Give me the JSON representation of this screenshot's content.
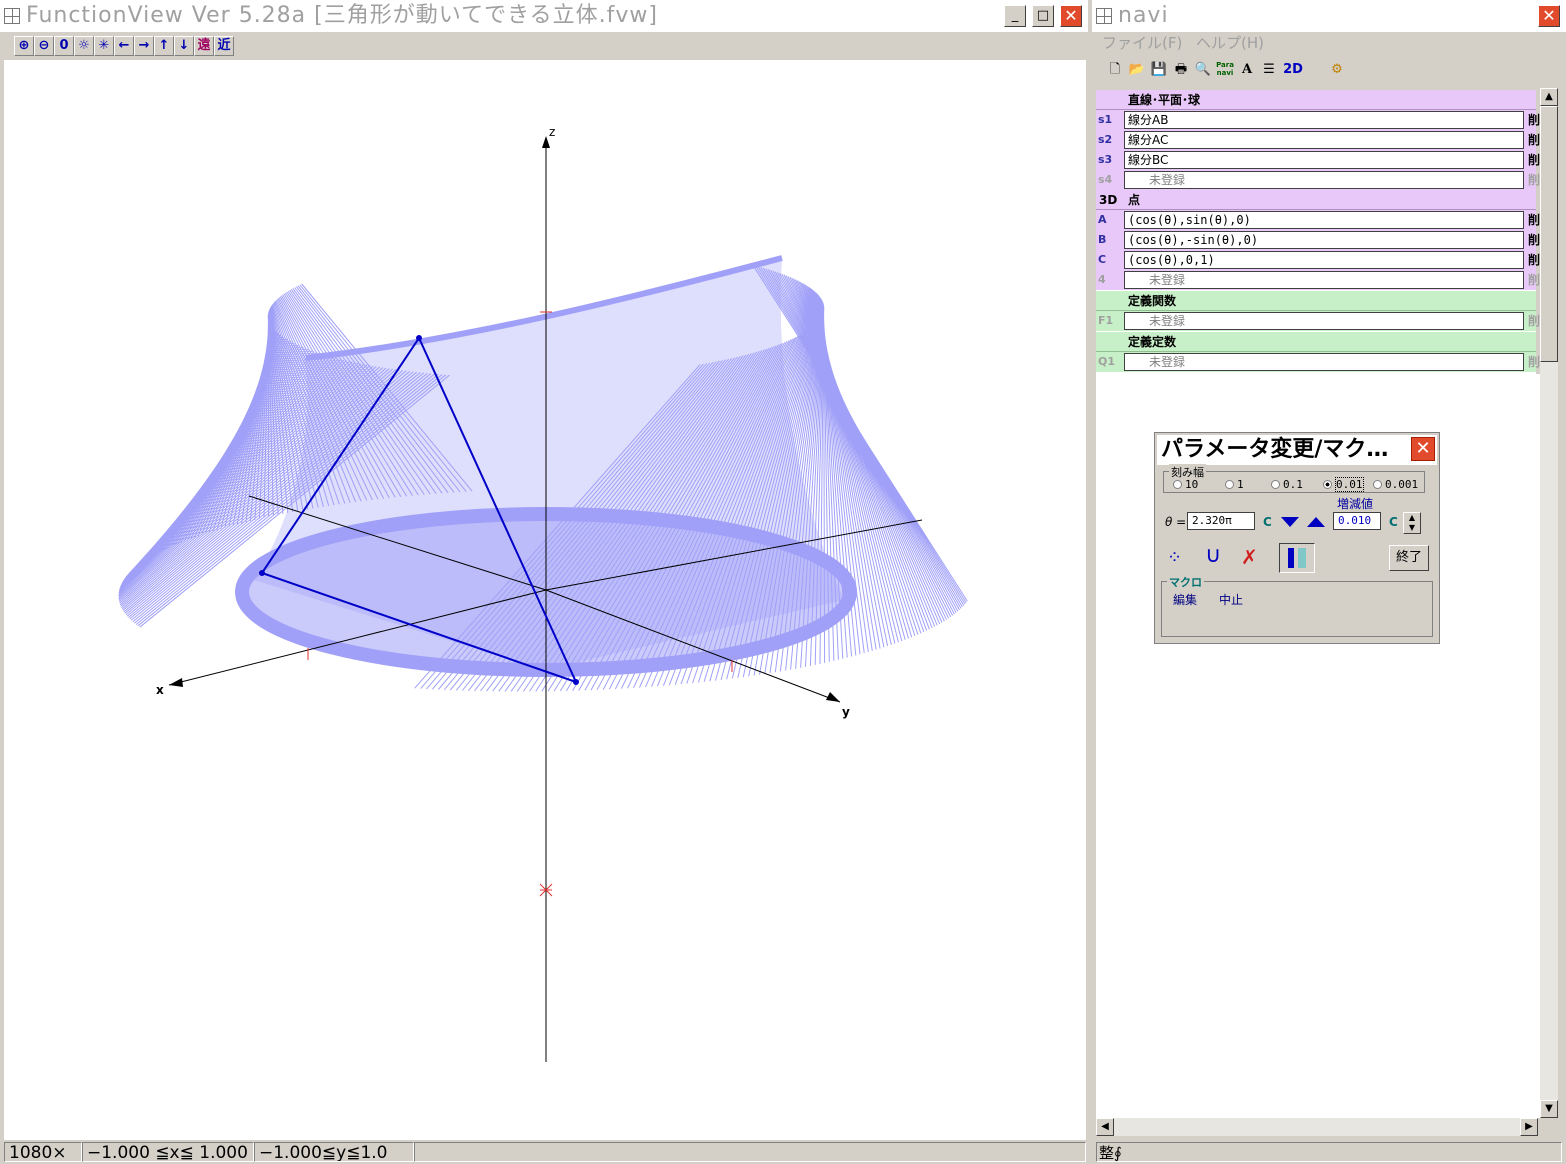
{
  "main_window": {
    "title": "FunctionView  Ver  5.28a  [三角形が動いてできる立体.fvw]",
    "toolbar": [
      "⊕",
      "⊖",
      "0",
      "☼",
      "✳",
      "←",
      "→",
      "↑",
      "↓",
      "遠",
      "近"
    ],
    "min_label": "_",
    "max_label": "□",
    "close_label": "✕",
    "axis_labels": {
      "x": "x",
      "y": "y",
      "z": "z"
    },
    "status": {
      "size": "1080×",
      "xrange": "−1.000 ≦x≦ 1.000",
      "yrange": "−1.000≦y≦1.0"
    }
  },
  "navi_window": {
    "title": "navi",
    "close_label": "✕",
    "menu": {
      "file": "ファイル(F)",
      "help": "ヘルプ(H)"
    },
    "toolbar": [
      "🗋",
      "📂",
      "💾",
      "🖶",
      "🔍",
      "Para navi",
      "A",
      "☰",
      "2D",
      "⚙"
    ],
    "sections": {
      "lines": {
        "label": "直線･平面･球"
      },
      "points": {
        "key": "3D",
        "label": "点"
      },
      "functions": {
        "label": "定義関数"
      },
      "constants": {
        "label": "定義定数"
      }
    },
    "rows": {
      "s1": {
        "key": "s1",
        "value": "線分AB",
        "del": "削"
      },
      "s2": {
        "key": "s2",
        "value": "線分AC",
        "del": "削"
      },
      "s3": {
        "key": "s3",
        "value": "線分BC",
        "del": "削"
      },
      "s4": {
        "key": "s4",
        "value": "未登録",
        "del": "削"
      },
      "A": {
        "key": "A",
        "value": "(cos(θ),sin(θ),0)",
        "del": "削"
      },
      "B": {
        "key": "B",
        "value": "(cos(θ),-sin(θ),0)",
        "del": "削"
      },
      "C": {
        "key": "C",
        "value": "(cos(θ),0,1)",
        "del": "削"
      },
      "p4": {
        "key": "4",
        "value": "未登録",
        "del": "削"
      },
      "F1": {
        "key": "F1",
        "value": "未登録",
        "del": "削"
      },
      "Q1": {
        "key": "Q1",
        "value": "未登録",
        "del": "削"
      }
    },
    "status": "整∮"
  },
  "param_dialog": {
    "title": "パラメータ変更/マク…",
    "close_label": "✕",
    "step_label": "刻み幅",
    "steps": [
      "10",
      "1",
      "0.1",
      "0.01",
      "0.001"
    ],
    "selected_step": "0.01",
    "increment_label": "増減値",
    "theta_label": "θ =",
    "theta_value": "2.320π",
    "c_label": "C",
    "increment_value": "0.010",
    "c2_label": "C",
    "end_button": "終了",
    "macro_label": "マクロ",
    "macro_edit": "編集",
    "macro_stop": "中止"
  },
  "colors": {
    "surface": "#a0a0f8",
    "triangle": "#0000c8",
    "axis": "#000000",
    "tick": "#e03030"
  }
}
